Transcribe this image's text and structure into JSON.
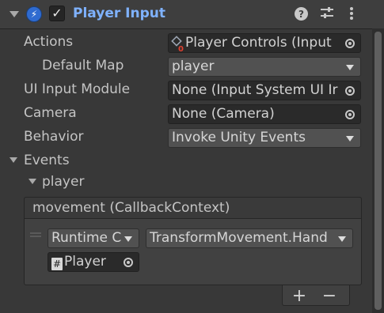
{
  "header": {
    "title": "Player Input",
    "enabled": true,
    "icons": [
      "lightning-bolt-icon",
      "help-icon",
      "settings-sliders-icon",
      "more-vertical-icon"
    ]
  },
  "properties": {
    "actions": {
      "label": "Actions",
      "value": "Player Controls (Input"
    },
    "default_map": {
      "label": "Default Map",
      "value": "player"
    },
    "ui_input_module": {
      "label": "UI Input Module",
      "value": "None (Input System UI Ir"
    },
    "camera": {
      "label": "Camera",
      "value": "None (Camera)"
    },
    "behavior": {
      "label": "Behavior",
      "value": "Invoke Unity Events"
    }
  },
  "events": {
    "label": "Events",
    "group_label": "player",
    "event_title": "movement (CallbackContext)",
    "listener": {
      "runtime_mode": "Runtime C",
      "function": "TransformMovement.Hand",
      "target_object": "Player"
    },
    "footer": {
      "add_label": "+",
      "remove_label": "−"
    }
  },
  "colors": {
    "title": "#7fb2ff",
    "component_icon": "#2f6bd0",
    "background": "#383838"
  }
}
